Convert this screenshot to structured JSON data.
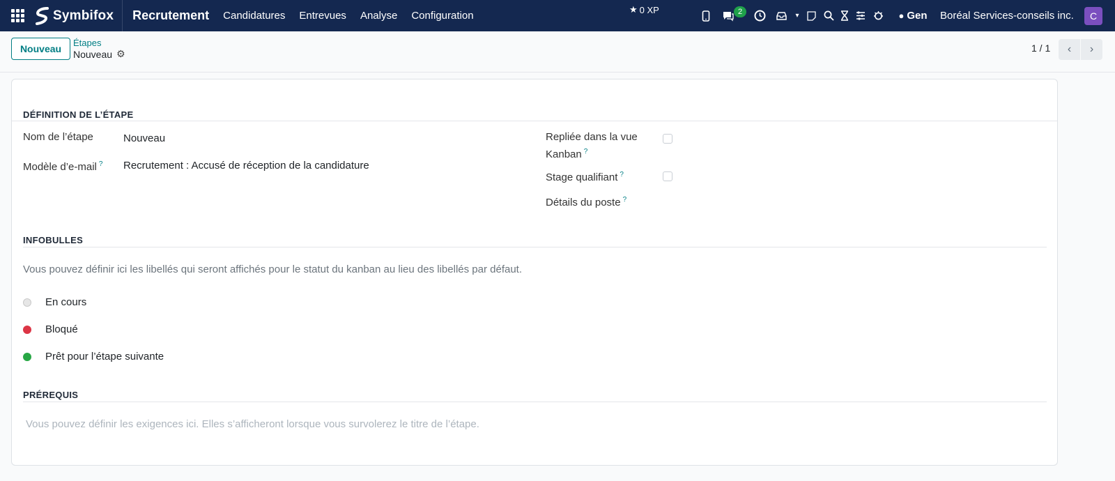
{
  "navbar": {
    "brand": "Symbifox",
    "app_title": "Recrutement",
    "menu": [
      "Candidatures",
      "Entrevues",
      "Analyse",
      "Configuration"
    ],
    "xp": "0 XP",
    "messages_count": "2",
    "assistant_label": "Gen",
    "company": "Boréal Services-conseils inc.",
    "avatar_initial": "C"
  },
  "control": {
    "new_button": "Nouveau",
    "breadcrumb_parent": "Étapes",
    "breadcrumb_current": "Nouveau",
    "pager": "1 / 1"
  },
  "form": {
    "definition_title": "Définition de l’étape",
    "stage_name_label": "Nom de l’étape",
    "stage_name_value": "Nouveau",
    "email_template_label": "Modèle d’e-mail",
    "email_template_value": "Recrutement : Accusé de réception de la candidature",
    "folded_label_line1": "Repliée dans la vue",
    "folded_label_line2": "Kanban",
    "qualifying_label": "Stage qualifiant",
    "job_details_label": "Détails du poste",
    "tooltips_title": "Infobulles",
    "tooltips_note": "Vous pouvez définir ici les libellés qui seront affichés pour le statut du kanban au lieu des libellés par défaut.",
    "states": [
      {
        "label": "En cours",
        "color": "#e6e6e6"
      },
      {
        "label": "Bloqué",
        "color": "#dc3545"
      },
      {
        "label": "Prêt pour l’étape suivante",
        "color": "#28a745"
      }
    ],
    "requirements_title": "Prérequis",
    "requirements_placeholder": "Vous pouvez définir les exigences ici. Elles s’afficheront lorsque vous survolerez le titre de l’étape."
  },
  "colors": {
    "navbar_bg": "#142850",
    "accent": "#017e84",
    "avatar_bg": "#7b4fbf"
  }
}
